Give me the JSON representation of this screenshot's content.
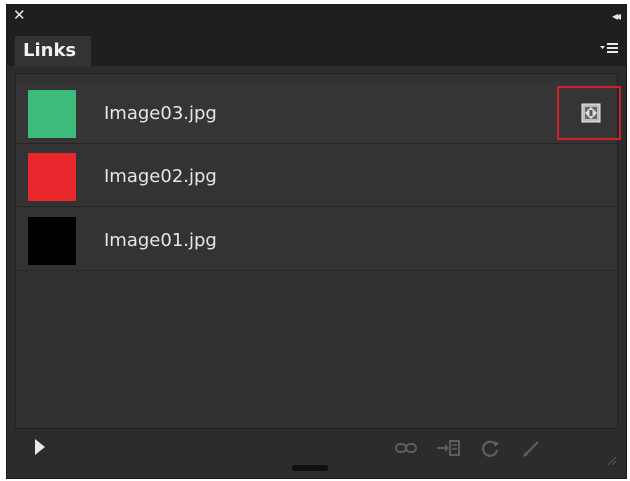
{
  "window": {
    "close_icon": "close-icon",
    "collapse_icon": "collapse-panel-icon"
  },
  "tabs": [
    {
      "label": "Links"
    }
  ],
  "panel_menu_icon": "panel-menu-icon",
  "links": [
    {
      "name": "Image03.jpg",
      "thumbnail_color": "#3dbb7a",
      "status": "modified",
      "status_icon": "modified-link-icon",
      "highlighted": true
    },
    {
      "name": "Image02.jpg",
      "thumbnail_color": "#e8282d"
    },
    {
      "name": "Image01.jpg",
      "thumbnail_color": "#000000"
    }
  ],
  "footer": {
    "show_options_icon": "disclosure-triangle-icon",
    "tools": [
      {
        "icon": "relink-icon"
      },
      {
        "icon": "go-to-link-icon"
      },
      {
        "icon": "update-link-icon"
      },
      {
        "icon": "edit-original-icon"
      }
    ]
  },
  "colors": {
    "panel_bg": "#2c2c2c",
    "title_bar": "#1f1f1f",
    "highlight_border": "#d0212a"
  }
}
